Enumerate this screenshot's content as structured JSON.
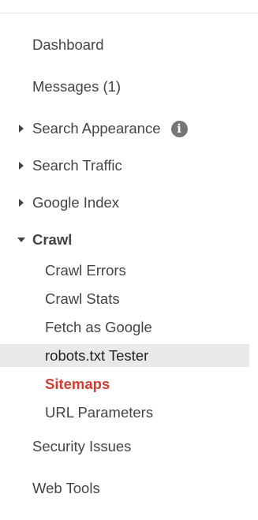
{
  "nav": {
    "dashboard": "Dashboard",
    "messages": "Messages (1)",
    "search_appearance": "Search Appearance",
    "search_traffic": "Search Traffic",
    "google_index": "Google Index",
    "crawl": "Crawl",
    "crawl_items": [
      {
        "label": "Crawl Errors"
      },
      {
        "label": "Crawl Stats"
      },
      {
        "label": "Fetch as Google"
      },
      {
        "label": "robots.txt Tester",
        "selected": true
      },
      {
        "label": "Sitemaps",
        "active": true
      },
      {
        "label": "URL Parameters"
      }
    ],
    "security_issues": "Security Issues",
    "web_tools": "Web Tools"
  },
  "icons": {
    "info": "info-icon",
    "collapsed": "caret-right-icon",
    "expanded": "caret-down-icon"
  },
  "colors": {
    "active_link": "#d23f31",
    "selected_bg": "#e9e9e9",
    "text": "#444444"
  }
}
